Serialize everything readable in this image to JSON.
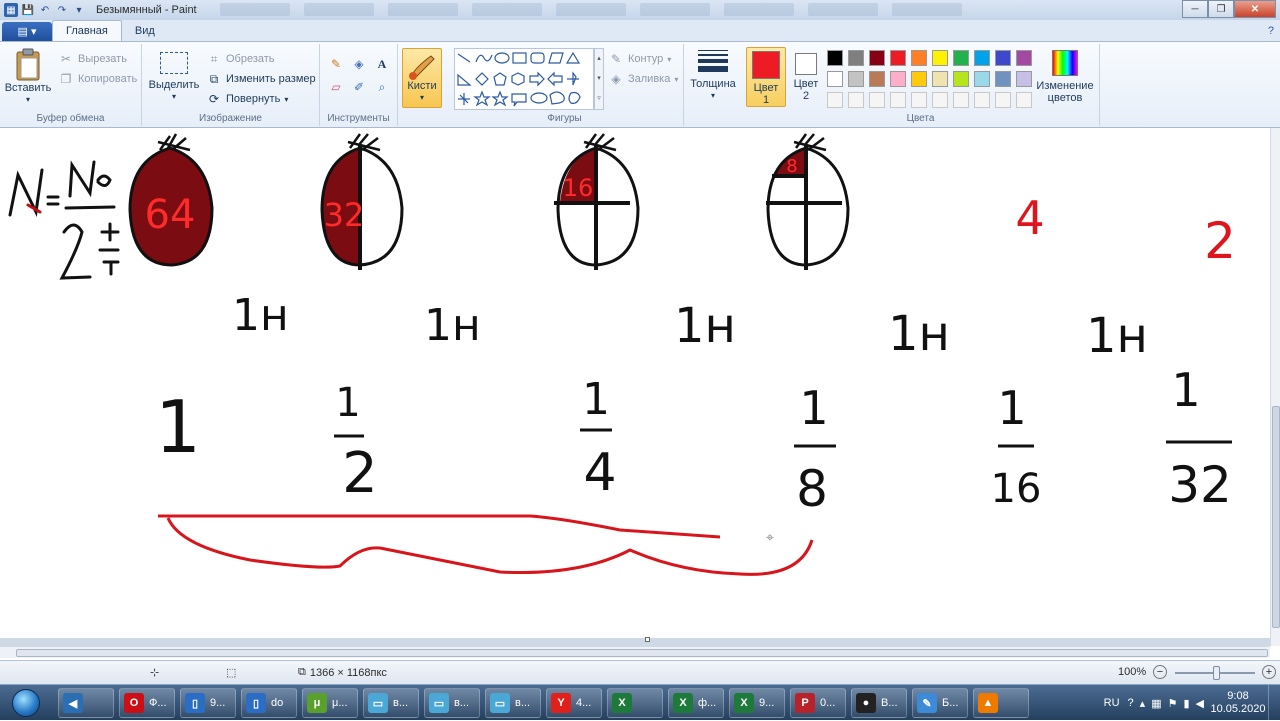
{
  "window": {
    "title": "Безымянный - Paint",
    "qat": [
      "save-icon",
      "undo-icon",
      "redo-icon",
      "dropdown-icon"
    ],
    "controls": {
      "minimize": "─",
      "maximize": "❐",
      "close": "✕"
    }
  },
  "ribbon_tabs": [
    {
      "label": "Главная",
      "active": true
    },
    {
      "label": "Вид",
      "active": false
    }
  ],
  "groups": {
    "clipboard": {
      "label": "Буфер обмена",
      "paste": "Вставить",
      "cut": "Вырезать",
      "copy": "Копировать"
    },
    "image": {
      "label": "Изображение",
      "select": "Выделить",
      "crop": "Обрезать",
      "resize": "Изменить размер",
      "rotate": "Повернуть"
    },
    "tools": {
      "label": "Инструменты"
    },
    "brushes": {
      "label": "Кисти"
    },
    "shapes": {
      "label": "Фигуры",
      "outline": "Контур",
      "fill": "Заливка"
    },
    "size": {
      "label": "Толщина"
    },
    "colors": {
      "label": "Цвета",
      "color1": "Цвет 1",
      "color2": "Цвет 2",
      "edit": "Изменение цветов",
      "color1_value": "#ed1c24",
      "color2_value": "#ffffff",
      "palette_row1": [
        "#000000",
        "#7f7f7f",
        "#880015",
        "#ed1c24",
        "#ff7f27",
        "#fff200",
        "#22b14c",
        "#00a2e8",
        "#3f48cc",
        "#a349a4"
      ],
      "palette_row2": [
        "#ffffff",
        "#c3c3c3",
        "#b97a57",
        "#ffaec9",
        "#ffc90e",
        "#efe4b0",
        "#b5e61d",
        "#99d9ea",
        "#7092be",
        "#c8bfe7"
      ],
      "palette_row3": [
        "#f5f5f5",
        "#f5f5f5",
        "#f5f5f5",
        "#f5f5f5",
        "#f5f5f5",
        "#f5f5f5",
        "#f5f5f5",
        "#f5f5f5",
        "#f5f5f5",
        "#f5f5f5"
      ]
    }
  },
  "canvas": {
    "formula": {
      "lhs": "N",
      "eq": "=",
      "numerator": "N₀",
      "base": "2",
      "exp_num": "t",
      "exp_den": "T"
    },
    "bags": [
      "64",
      "32",
      "16",
      "8"
    ],
    "red_numbers": [
      "4",
      "2"
    ],
    "row_h": [
      "1н",
      "1н",
      "1н",
      "1н",
      "1н"
    ],
    "fractions": [
      {
        "num": "1",
        "den": ""
      },
      {
        "num": "1",
        "den": "2"
      },
      {
        "num": "1",
        "den": "4"
      },
      {
        "num": "1",
        "den": "8"
      },
      {
        "num": "1",
        "den": "16"
      },
      {
        "num": "1",
        "den": "32"
      }
    ]
  },
  "status": {
    "size": "1366 × 1168пкс",
    "zoom": "100%"
  },
  "taskbar": {
    "buttons": [
      {
        "label": "",
        "icon": "speaker-icon",
        "color": "#2a6fb4"
      },
      {
        "label": "Ф...",
        "icon": "opera-icon",
        "color": "#cc0f16"
      },
      {
        "label": "9...",
        "icon": "folder-icon",
        "color": "#2b6cc4"
      },
      {
        "label": "do",
        "icon": "folder-icon",
        "color": "#2b6cc4"
      },
      {
        "label": "μ...",
        "icon": "utorrent-icon",
        "color": "#5aa02c"
      },
      {
        "label": "в...",
        "icon": "notepad-icon",
        "color": "#4aa7d6"
      },
      {
        "label": "в...",
        "icon": "notepad-icon",
        "color": "#4aa7d6"
      },
      {
        "label": "в...",
        "icon": "notepad-icon",
        "color": "#4aa7d6"
      },
      {
        "label": "4...",
        "icon": "yandex-icon",
        "color": "#e0201b"
      },
      {
        "label": "",
        "icon": "excel-icon",
        "color": "#1d7a3b"
      },
      {
        "label": "ф...",
        "icon": "excel-icon",
        "color": "#1d7a3b"
      },
      {
        "label": "9...",
        "icon": "excel-icon",
        "color": "#1d7a3b"
      },
      {
        "label": "0...",
        "icon": "pdf-icon",
        "color": "#b8232a"
      },
      {
        "label": "В...",
        "icon": "record-icon",
        "color": "#222"
      },
      {
        "label": "Б...",
        "icon": "paint-icon",
        "color": "#3c8ad8"
      },
      {
        "label": "",
        "icon": "vlc-icon",
        "color": "#ee7b00"
      }
    ],
    "lang": "RU",
    "time": "9:08",
    "date": "10.05.2020"
  }
}
